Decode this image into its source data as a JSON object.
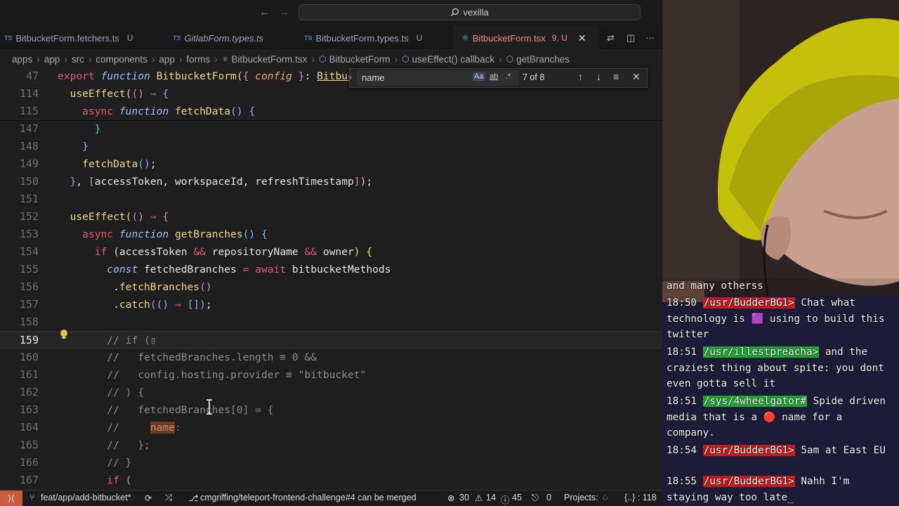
{
  "titlebar": {
    "search_text": "vexilla",
    "back_arrow": "←",
    "forward_arrow": "→"
  },
  "tabs": [
    {
      "lang": "TS",
      "label": "BitbucketForm.fetchers.ts",
      "status": "U"
    },
    {
      "lang": "TS",
      "label": "GitlabForm.types.ts",
      "status": ""
    },
    {
      "lang": "TS",
      "label": "BitbucketForm.types.ts",
      "status": "U"
    },
    {
      "lang": "⚛",
      "label": "BitbucketForm.tsx",
      "status": "9, U"
    }
  ],
  "breadcrumb": [
    "apps",
    "app",
    "src",
    "components",
    "app",
    "forms",
    "BitbucketForm.tsx",
    "BitbucketForm",
    "useEffect() callback",
    "getBranches"
  ],
  "find": {
    "value": "name",
    "match_case": "Aa",
    "whole_word": "ab",
    "regex": ".*",
    "count": "7 of 8"
  },
  "lines": [
    {
      "n": "47",
      "html": "<span class='kw'>export</span> <span class='kwi'>function</span> <span class='fn'>BitbucketForm</span><span class='br1'>(</span><span class='br2'>{</span> <span class='kwi' style='color:#f0a96b'>config</span> <span class='br2'>}</span>: <span class='fn' style='text-decoration:underline'>BitbucketF</span>"
    },
    {
      "n": "114",
      "html": "  <span class='fn'>useEffect</span><span class='br1'>(</span><span class='br2'>()</span> <span class='op'>⇒</span> <span class='br2'>{</span>"
    },
    {
      "n": "115",
      "html": "    <span class='kw'>async</span> <span class='kwi'>function</span> <span class='fn'>fetchData</span><span class='br3'>()</span> <span class='br3'>{</span>"
    },
    {
      "n": "147",
      "html": "      <span class='br3'>}</span>"
    },
    {
      "n": "148",
      "html": "    <span class='br3'>}</span>"
    },
    {
      "n": "149",
      "html": "    <span class='fn'>fetchData</span><span class='br3'>()</span>;"
    },
    {
      "n": "150",
      "html": "  <span class='br2'>}</span>, <span class='br2'>[</span>accessToken, workspaceId, refreshTimestamp<span class='br2'>]</span><span class='br1'>)</span>;"
    },
    {
      "n": "151",
      "html": ""
    },
    {
      "n": "152",
      "html": "  <span class='fn'>useEffect</span><span class='br1'>(</span><span class='br2'>()</span> <span class='op'>⇒</span> <span class='br2'>{</span>"
    },
    {
      "n": "153",
      "html": "    <span class='kw'>async</span> <span class='kwi'>function</span> <span class='fn'>getBranches</span><span class='br3'>()</span> <span class='br3'>{</span>"
    },
    {
      "n": "154",
      "html": "      <span class='kw'>if</span> <span class='br1'>(</span>accessToken <span class='op'>&amp;&amp;</span> repositoryName <span class='op'>&amp;&amp;</span> owner<span class='br1'>)</span> <span class='br1'>{</span>"
    },
    {
      "n": "155",
      "html": "        <span class='kwi'>const</span> fetchedBranches <span class='op'>=</span> <span class='kw'>await</span> bitbucketMethods"
    },
    {
      "n": "156",
      "html": "         .<span class='fn'>fetchBranches</span><span class='br2'>()</span>"
    },
    {
      "n": "157",
      "html": "         .<span class='fn'>catch</span><span class='br2'>(</span><span class='br3'>()</span> <span class='op'>⇒</span> <span class='br3'>[]</span><span class='br2'>)</span>;"
    },
    {
      "n": "158",
      "html": ""
    },
    {
      "n": "159",
      "html": "        <span class='cm'>// if (▯</span>"
    },
    {
      "n": "160",
      "html": "        <span class='cm'>//   fetchedBranches.length ≡ 0 &amp;&amp;</span>"
    },
    {
      "n": "161",
      "html": "        <span class='cm'>//   config.hosting.provider ≡ \"bitbucket\"</span>"
    },
    {
      "n": "162",
      "html": "        <span class='cm'>// ) {</span>"
    },
    {
      "n": "163",
      "html": "        <span class='cm'>//   fetchedBranches[0] = {</span>"
    },
    {
      "n": "164",
      "html": "        <span class='cm'>//     <span class='hl'>name</span>:</span>"
    },
    {
      "n": "165",
      "html": "        <span class='cm'>//   };</span>"
    },
    {
      "n": "166",
      "html": "        <span class='cm'>// }</span>"
    },
    {
      "n": "167",
      "html": "        <span class='kw'>if</span> <span class='br2'>(</span>"
    }
  ],
  "statusbar": {
    "branch": "feat/app/add-bitbucket*",
    "pr": "cmgriffing/teleport-frontend-challenge#4 can be merged",
    "errors": "30",
    "warnings": "14",
    "info": "45",
    "ports": "0",
    "projects": "Projects:",
    "lang": "{..} : 118"
  },
  "chat": [
    {
      "time": "",
      "user": "",
      "color": "",
      "text": "and many otherss"
    },
    {
      "time": "18:50",
      "user": "/usr/BudderBG1>",
      "color": "red",
      "text": "Chat what technology is 🟪 using to build this twitter"
    },
    {
      "time": "18:51",
      "user": "/usr/illestpreacha>",
      "color": "green",
      "text": "and the craziest thing about spite: you dont even gotta sell it"
    },
    {
      "time": "18:51",
      "user": "/sys/4wheelgator#",
      "color": "green",
      "text": "Spide driven media that is a 🔴 name for a company."
    },
    {
      "time": "18:54",
      "user": "/usr/BudderBG1>",
      "color": "red",
      "text": "5am at East EU"
    },
    {
      "time": "18:55",
      "user": "/usr/BudderBG1>",
      "color": "red",
      "text": "Nahh I'm staying way too late_"
    }
  ],
  "colors": {
    "accent_remote": "#cc5b3d",
    "username_red": "#c8191c",
    "username_green": "#1fa632",
    "hat_yellow": "#c4c20a"
  }
}
